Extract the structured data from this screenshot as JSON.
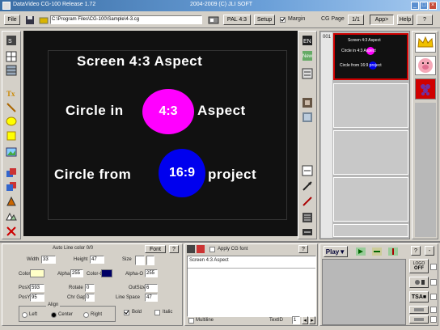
{
  "window": {
    "title": "DataVideo CG-100  Release 1.72",
    "title_right": "2004-2009 (C) JLI SOFT"
  },
  "toolbar": {
    "file_label": "File",
    "path": "C:\\Program Files\\CG-100\\Sample\\4-3.cg",
    "pal": "PAL 4:3",
    "setup": "Setup",
    "margin": "Margin",
    "cg_page_label": "CG Page",
    "page_counter": "1/1",
    "app_label": "App>",
    "help_label": "Help",
    "question": "?"
  },
  "screen": {
    "line1": "Screen 4:3 Aspect",
    "line2_left": "Circle in",
    "circle1_text": "4:3",
    "line2_right": "Aspect",
    "line3_left": "Circle from",
    "circle2_text": "16:9",
    "line3_right": "project",
    "circle1_color": "#ff00ff",
    "circle2_color": "#0000ee"
  },
  "right_toolbar": {
    "en_label": "EN",
    "new_label": "New"
  },
  "preview": {
    "line1": "Screen 4:3 Aspect",
    "line2": "Circle in 4:3 Aspect",
    "line3": "Circle from 16:9 project"
  },
  "props": {
    "title": "Auto Line color 0/0",
    "font_btn": "Font",
    "width_label": "Width",
    "width_val": "33",
    "height_label": "Height",
    "height_val": "47",
    "size_label": "Size",
    "color_label": "Color",
    "alpha_label": "Alpha",
    "alpha_val": "255",
    "color_o_label": "Color-O",
    "alpha_o_label": "Alpha-O",
    "alpha_o_val": "255",
    "posx_label": "PosX",
    "posx_val": "593",
    "rotate_label": "Rotate",
    "rotate_val": "0",
    "outsize_label": "OutSize",
    "outsize_val": "6",
    "posy_label": "PosY",
    "posy_val": "95",
    "chrgap_label": "Chr Gap",
    "chrgap_val": "0",
    "linespace_label": "Line Space",
    "linespace_val": "47",
    "align_label": "Align",
    "left_label": "Left",
    "center_label": "Center",
    "right_label": "Right",
    "bold_label": "Bold",
    "italic_label": "Italic"
  },
  "text_panel": {
    "apply_label": "Apply CG font",
    "question": "?",
    "text_value": "Screen 4:3 Aspect",
    "multiline_label": "Multiline",
    "textid_label": "TextID",
    "textid_val": "1"
  },
  "play_panel": {
    "play_label": "Play",
    "question": "?",
    "logo_label": "LOGO",
    "off_label": "OFF",
    "tsa_label": "TSA"
  }
}
